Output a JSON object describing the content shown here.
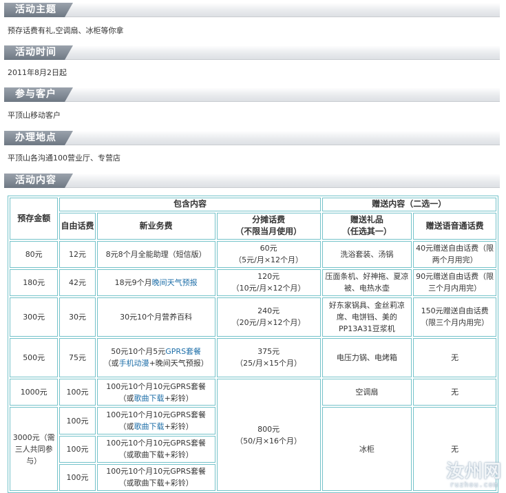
{
  "sections": [
    {
      "title": "活动主题",
      "text": "预存话费有礼,空调扇、冰柜等你拿"
    },
    {
      "title": "活动时间",
      "text": "2011年8月2日起"
    },
    {
      "title": "参与客户",
      "text": "平顶山移动客户"
    },
    {
      "title": "办理地点",
      "text": "平顶山各沟通100营业厅、专营店"
    },
    {
      "title": "活动内容"
    }
  ],
  "table": {
    "headers": {
      "deposit": "预存金额",
      "included": "包含内容",
      "gift_group": "赠送内容（二选一）",
      "free_fee": "自由话费",
      "new_service": "新业务费",
      "split_fee": "分摊话费",
      "split_fee_note": "（不限当月使用）",
      "gift": "赠送礼品",
      "gift_note": "（任选其一）",
      "voice_fee": "赠送语音通话费"
    },
    "rows": [
      {
        "deposit": "80元",
        "free_fee": "12元",
        "new_service": "8元8个月全能助理（短信版）",
        "split_fee": "60元",
        "split_fee_detail": "（5元/月×12个月）",
        "gift": "洗浴套装、汤锅",
        "voice_fee": "40元赠送自由话费（限两个月用完）"
      },
      {
        "deposit": "180元",
        "free_fee": "42元",
        "new_service_a": "18元9个月",
        "new_service_link": "晚间天气预报",
        "split_fee": "120元",
        "split_fee_detail": "（10元/月×12个月）",
        "gift": "压面条机、好神拖、夏凉被、电热水壶",
        "voice_fee": "90元赠送自由话费（限三个月内用完）"
      },
      {
        "deposit": "300元",
        "free_fee": "30元",
        "new_service": "30元10个月营养百科",
        "split_fee": "240元",
        "split_fee_detail": "（20元/月×12个月）",
        "gift": "好东家锅具、金丝莉凉席、电饼铛、美的PP13A31豆浆机",
        "voice_fee": "150元赠送自由话费（限三个月内用完）"
      },
      {
        "deposit": "500元",
        "free_fee": "75元",
        "new_service_a": "50元10个月5元",
        "new_service_link": "GPRS套餐",
        "new_service_b": "（或",
        "new_service_link2": "手机动漫",
        "new_service_c": "+晚间天气预报）",
        "split_fee": "375元",
        "split_fee_detail": "（25/月×15个月）",
        "gift": "电压力锅、电烤箱",
        "voice_fee": "无"
      },
      {
        "deposit": "1000元",
        "free_fee": "100元",
        "new_service_a": "100元10个月10元GPRS套餐",
        "new_service_b": "（或",
        "new_service_link": "歌曲下载",
        "new_service_c": "+彩铃）",
        "gift": "空调扇",
        "voice_fee": "无"
      },
      {
        "deposit": "3000元（需三人共同参与）",
        "free_fee": "100元",
        "new_service_a": "100元10个月10元GPRS套餐",
        "new_service_b": "（或",
        "new_service_link": "歌曲下载",
        "new_service_c": "+彩铃）",
        "gift": "冰柜",
        "voice_fee": "无"
      },
      {
        "free_fee": "100元",
        "new_service_a": "100元10个月10元GPRS套餐",
        "new_service_b": "（或歌曲下载+彩铃）"
      },
      {
        "free_fee": "100元",
        "new_service_a": "100元10个月10元GPRS套餐",
        "new_service_b": "（或歌曲下载+彩铃）"
      }
    ],
    "merged_split_fee": "800元",
    "merged_split_fee_detail": "（50/月×16个月）"
  },
  "watermark": {
    "cn": "汝州网",
    "en": "ruzhou.com"
  }
}
